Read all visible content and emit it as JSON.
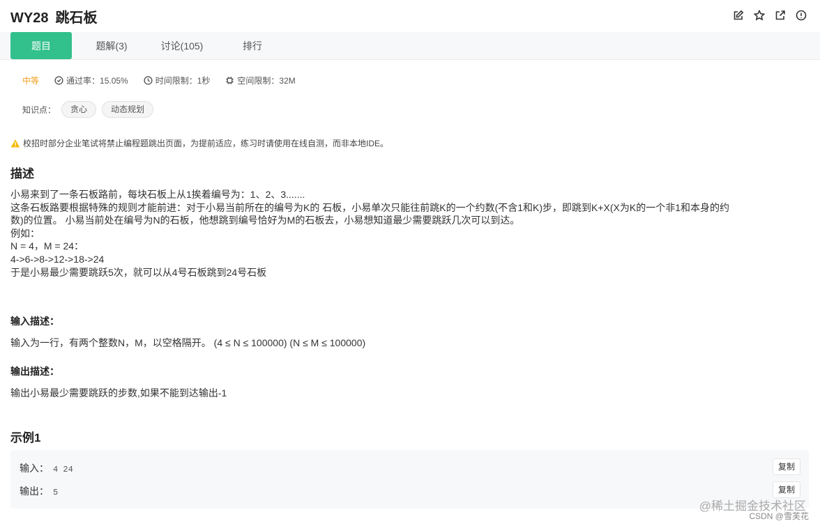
{
  "header": {
    "id": "WY28",
    "title": "跳石板"
  },
  "tabs": [
    {
      "label": "题目",
      "active": true
    },
    {
      "label": "题解(3)"
    },
    {
      "label": "讨论(105)"
    },
    {
      "label": "排行"
    }
  ],
  "meta": {
    "level": "中等",
    "pass_rate": "通过率：15.05%",
    "time_limit": "时间限制：1秒",
    "space_limit": "空间限制：32M"
  },
  "knowledge": {
    "label": "知识点：",
    "tags": [
      "贪心",
      "动态规划"
    ]
  },
  "warning": "校招时部分企业笔试将禁止编程题跳出页面，为提前适应，练习时请使用在线自测，而非本地IDE。",
  "description": {
    "heading": "描述",
    "lines": [
      "小易来到了一条石板路前，每块石板上从1挨着编号为：1、2、3.......",
      "这条石板路要根据特殊的规则才能前进：对于小易当前所在的编号为K的 石板，小易单次只能往前跳K的一个约数(不含1和K)步，即跳到K+X(X为K的一个非1和本身的约",
      "数)的位置。 小易当前处在编号为N的石板，他想跳到编号恰好为M的石板去，小易想知道最少需要跳跃几次可以到达。",
      "例如：",
      "N = 4，M = 24：",
      "4->6->8->12->18->24",
      "于是小易最少需要跳跃5次，就可以从4号石板跳到24号石板"
    ]
  },
  "input_desc": {
    "heading": "输入描述：",
    "text": "输入为一行，有两个整数N，M，以空格隔开。 (4 ≤ N ≤ 100000) (N ≤ M ≤ 100000)"
  },
  "output_desc": {
    "heading": "输出描述：",
    "text": "输出小易最少需要跳跃的步数,如果不能到达输出-1"
  },
  "example": {
    "heading": "示例1",
    "input_label": "输入：",
    "input_value": "4 24",
    "output_label": "输出：",
    "output_value": "5",
    "copy_label": "复制"
  },
  "watermark": {
    "line1": "@稀土掘金技术社区",
    "line2": "CSDN @雪芙花"
  },
  "colors": {
    "accent": "#32c08d",
    "level": "#f0a020",
    "warning": "#f5b800"
  }
}
